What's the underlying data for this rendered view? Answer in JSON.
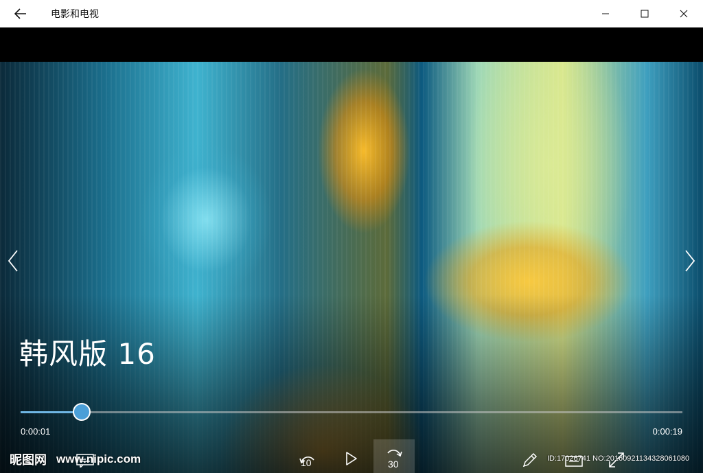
{
  "app": {
    "title": "电影和电视"
  },
  "video": {
    "title": "韩风版 16",
    "current_time": "0:00:01",
    "total_time": "0:00:19",
    "progress": 0.092
  },
  "controls": {
    "skip_back_label": "10",
    "skip_forward_label": "30"
  },
  "watermark": {
    "logo": "昵图网",
    "url": "www.nipic.com",
    "id_text": "ID:17026741 NO:20160921134328061080"
  },
  "colors": {
    "accent": "#4a9fd8",
    "titlebar_bg": "#ffffff"
  },
  "icons": {
    "back": "back-arrow-icon",
    "minimize": "minimize-icon",
    "maximize": "maximize-icon",
    "close": "close-icon",
    "prev": "chevron-left-icon",
    "next": "chevron-right-icon",
    "play": "play-icon",
    "skip_back": "skip-back-10-icon",
    "skip_forward": "skip-forward-30-icon",
    "subtitles": "subtitles-icon",
    "edit": "pencil-icon",
    "cast": "cast-icon",
    "fullscreen": "fullscreen-icon"
  }
}
